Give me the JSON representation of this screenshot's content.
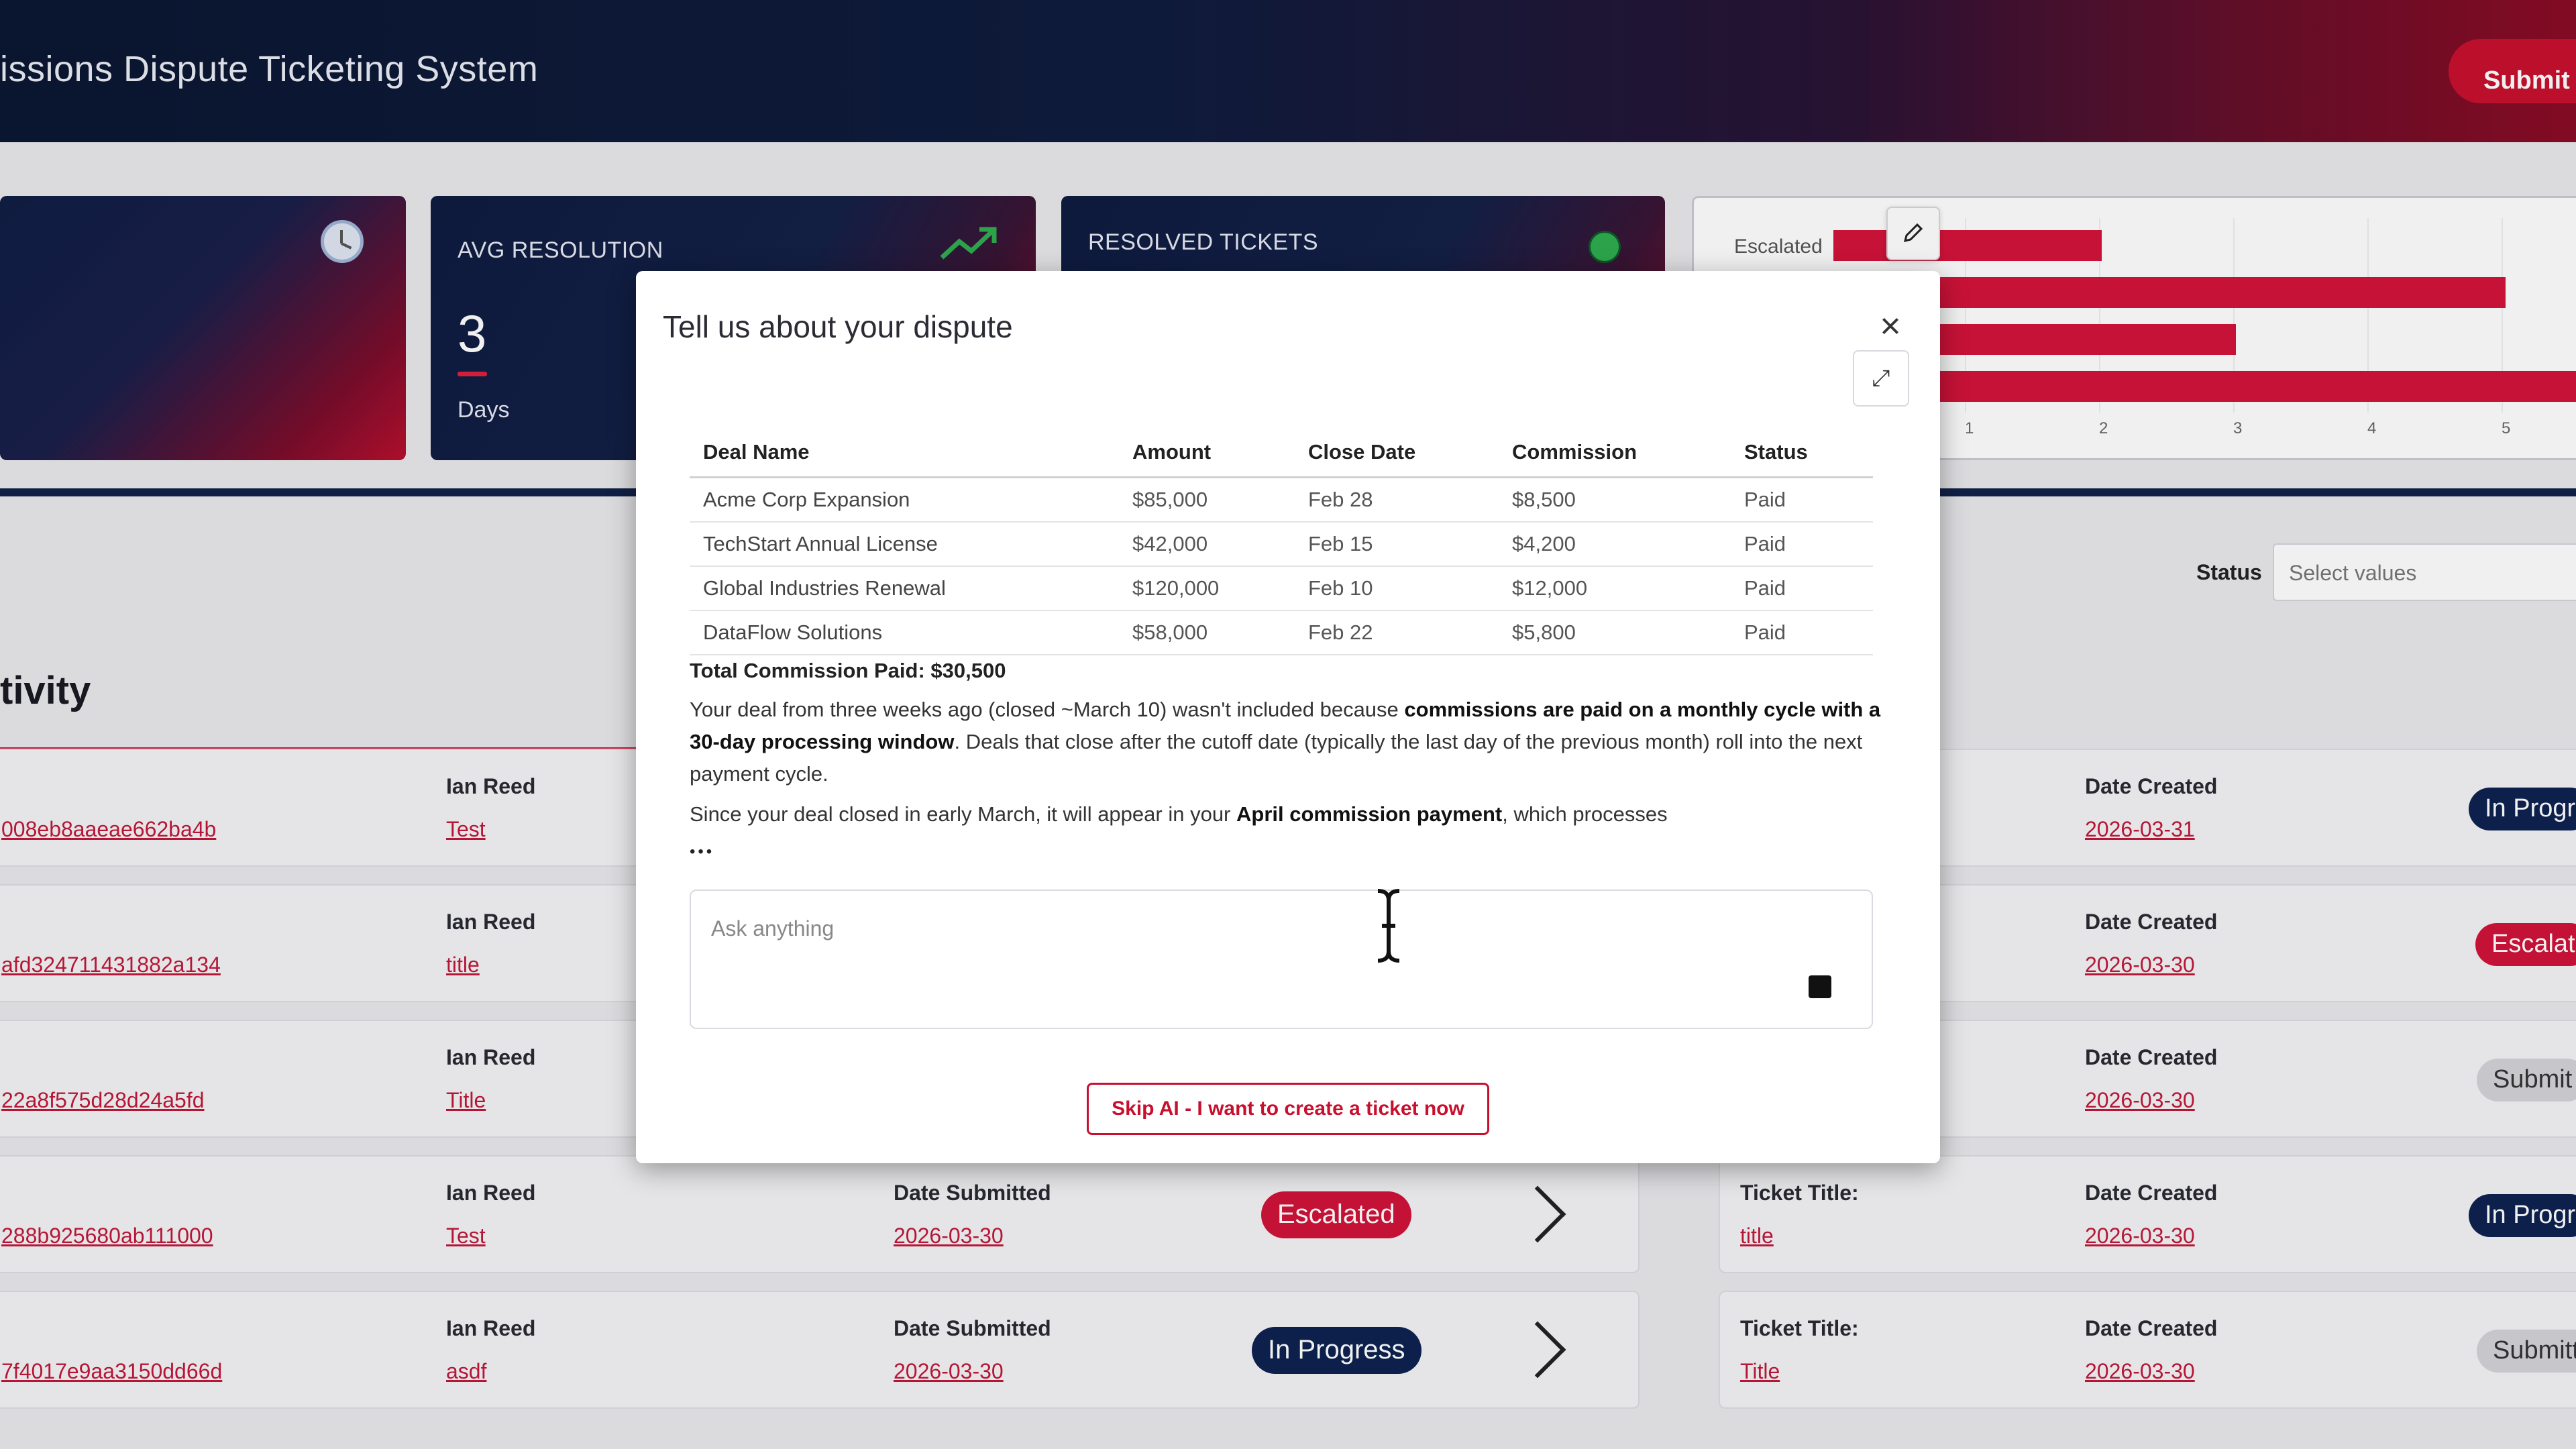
{
  "header": {
    "title": "issions Dispute Ticketing System",
    "submit_label": "Submit Ne"
  },
  "stats": [
    {
      "label": "",
      "value": "",
      "sub": ""
    },
    {
      "label": "AVG RESOLUTION",
      "value": "3",
      "sub": "Days"
    },
    {
      "label": "RESOLVED TICKETS",
      "value": "",
      "sub": ""
    }
  ],
  "status_chart": {
    "label_visible": "Escalated",
    "ticks": [
      "1",
      "2",
      "3",
      "4",
      "5"
    ]
  },
  "filter": {
    "label": "Status",
    "placeholder": "Select values"
  },
  "activity": {
    "title": "tivity"
  },
  "rows_left": [
    {
      "id": "008eb8aaeae662ba4b",
      "user": "Ian Reed",
      "title": "Test",
      "date_label": "",
      "date": "",
      "status": "",
      "status_type": ""
    },
    {
      "id": "afd324711431882a134",
      "user": "Ian Reed",
      "title": "title",
      "date_label": "",
      "date": "",
      "status": "",
      "status_type": ""
    },
    {
      "id": "22a8f575d28d24a5fd",
      "user": "Ian Reed",
      "title": "Title",
      "date_label": "",
      "date": "",
      "status": "",
      "status_type": ""
    },
    {
      "id": "288b925680ab111000",
      "user": "Ian Reed",
      "title": "Test",
      "date_label": "Date Submitted",
      "date": "2026-03-30",
      "status": "Escalated",
      "status_type": "esc"
    },
    {
      "id": "7f4017e9aa3150dd66d",
      "user": "Ian Reed",
      "title": "asdf",
      "date_label": "Date Submitted",
      "date": "2026-03-30",
      "status": "In Progress",
      "status_type": "prog"
    }
  ],
  "rows_right": [
    {
      "title_label": "",
      "title": "",
      "date_label": "Date Created",
      "date": "2026-03-31",
      "status": "In Progr",
      "status_type": "prog"
    },
    {
      "title_label": "",
      "title": "",
      "date_label": "Date Created",
      "date": "2026-03-30",
      "status": "Escalat",
      "status_type": "esc"
    },
    {
      "title_label": "",
      "title": "",
      "date_label": "Date Created",
      "date": "2026-03-30",
      "status": "Submit",
      "status_type": "sub"
    },
    {
      "title_label": "Ticket Title:",
      "title": "title",
      "date_label": "Date Created",
      "date": "2026-03-30",
      "status": "In Progr",
      "status_type": "prog"
    },
    {
      "title_label": "Ticket Title:",
      "title": "Title",
      "date_label": "Date Created",
      "date": "2026-03-30",
      "status": "Submitt",
      "status_type": "sub"
    }
  ],
  "modal": {
    "title": "Tell us about your dispute",
    "table": {
      "headers": [
        "Deal Name",
        "Amount",
        "Close Date",
        "Commission",
        "Status"
      ],
      "rows": [
        [
          "Acme Corp Expansion",
          "$85,000",
          "Feb 28",
          "$8,500",
          "Paid"
        ],
        [
          "TechStart Annual License",
          "$42,000",
          "Feb 15",
          "$4,200",
          "Paid"
        ],
        [
          "Global Industries Renewal",
          "$120,000",
          "Feb 10",
          "$12,000",
          "Paid"
        ],
        [
          "DataFlow Solutions",
          "$58,000",
          "Feb 22",
          "$5,800",
          "Paid"
        ]
      ]
    },
    "total": "Total Commission Paid: $30,500",
    "para1_a": "Your deal from three weeks ago (closed ~March 10) wasn't included because ",
    "para1_b": "commissions are paid on a monthly cycle with a 30-day processing window",
    "para1_c": ". Deals that close after the cutoff date (typically the last day of the previous month) roll into the next payment cycle.",
    "para2_a": "Since your deal closed in early March, it will appear in your ",
    "para2_b": "April commission payment",
    "para2_c": ", which processes",
    "typing_indicator": "•••",
    "ask_placeholder": "Ask anything",
    "skip_label": "Skip AI - I want to create a ticket now"
  }
}
